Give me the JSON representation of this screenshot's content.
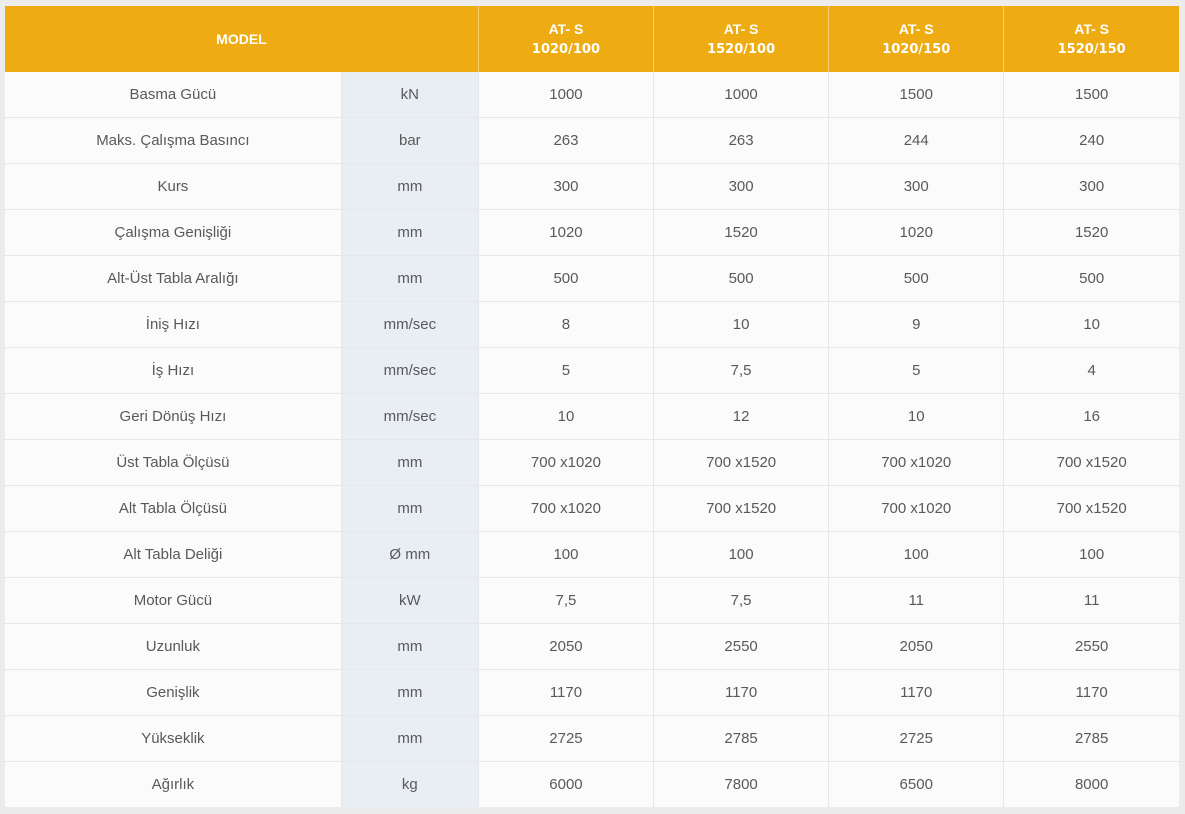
{
  "header": {
    "model_label": "MODEL",
    "models": [
      {
        "line1": "AT- S",
        "line2": "1020/100"
      },
      {
        "line1": "AT- S",
        "line2": "1520/100"
      },
      {
        "line1": "AT- S",
        "line2": "1020/150"
      },
      {
        "line1": "AT- S",
        "line2": "1520/150"
      }
    ]
  },
  "rows": [
    {
      "label": "Basma Gücü",
      "unit": "kN",
      "values": [
        "1000",
        "1000",
        "1500",
        "1500"
      ]
    },
    {
      "label": "Maks. Çalışma Basıncı",
      "unit": "bar",
      "values": [
        "263",
        "263",
        "244",
        "240"
      ]
    },
    {
      "label": "Kurs",
      "unit": "mm",
      "values": [
        "300",
        "300",
        "300",
        "300"
      ]
    },
    {
      "label": "Çalışma Genişliği",
      "unit": "mm",
      "values": [
        "1020",
        "1520",
        "1020",
        "1520"
      ]
    },
    {
      "label": "Alt-Üst Tabla Aralığı",
      "unit": "mm",
      "values": [
        "500",
        "500",
        "500",
        "500"
      ]
    },
    {
      "label": "İniş Hızı",
      "unit": "mm/sec",
      "values": [
        "8",
        "10",
        "9",
        "10"
      ]
    },
    {
      "label": "İş Hızı",
      "unit": "mm/sec",
      "values": [
        "5",
        "7,5",
        "5",
        "4"
      ]
    },
    {
      "label": "Geri Dönüş Hızı",
      "unit": "mm/sec",
      "values": [
        "10",
        "12",
        "10",
        "16"
      ]
    },
    {
      "label": "Üst Tabla Ölçüsü",
      "unit": "mm",
      "values": [
        "700 x1020",
        "700 x1520",
        "700 x1020",
        "700 x1520"
      ]
    },
    {
      "label": "Alt Tabla Ölçüsü",
      "unit": "mm",
      "values": [
        "700 x1020",
        "700 x1520",
        "700 x1020",
        "700 x1520"
      ]
    },
    {
      "label": "Alt Tabla Deliği",
      "unit": "Ø mm",
      "values": [
        "100",
        "100",
        "100",
        "100"
      ]
    },
    {
      "label": "Motor Gücü",
      "unit": "kW",
      "values": [
        "7,5",
        "7,5",
        "11",
        "11"
      ]
    },
    {
      "label": "Uzunluk",
      "unit": "mm",
      "values": [
        "2050",
        "2550",
        "2050",
        "2550"
      ]
    },
    {
      "label": "Genişlik",
      "unit": "mm",
      "values": [
        "1170",
        "1170",
        "1170",
        "1170"
      ]
    },
    {
      "label": "Yükseklik",
      "unit": "mm",
      "values": [
        "2725",
        "2785",
        "2725",
        "2785"
      ]
    },
    {
      "label": "Ağırlık",
      "unit": "kg",
      "values": [
        "6000",
        "7800",
        "6500",
        "8000"
      ]
    }
  ],
  "colors": {
    "header_bg": "#efac12",
    "unit_column_bg": "#e8eef4",
    "cell_bg": "#fbfbfb",
    "text": "#595959"
  }
}
